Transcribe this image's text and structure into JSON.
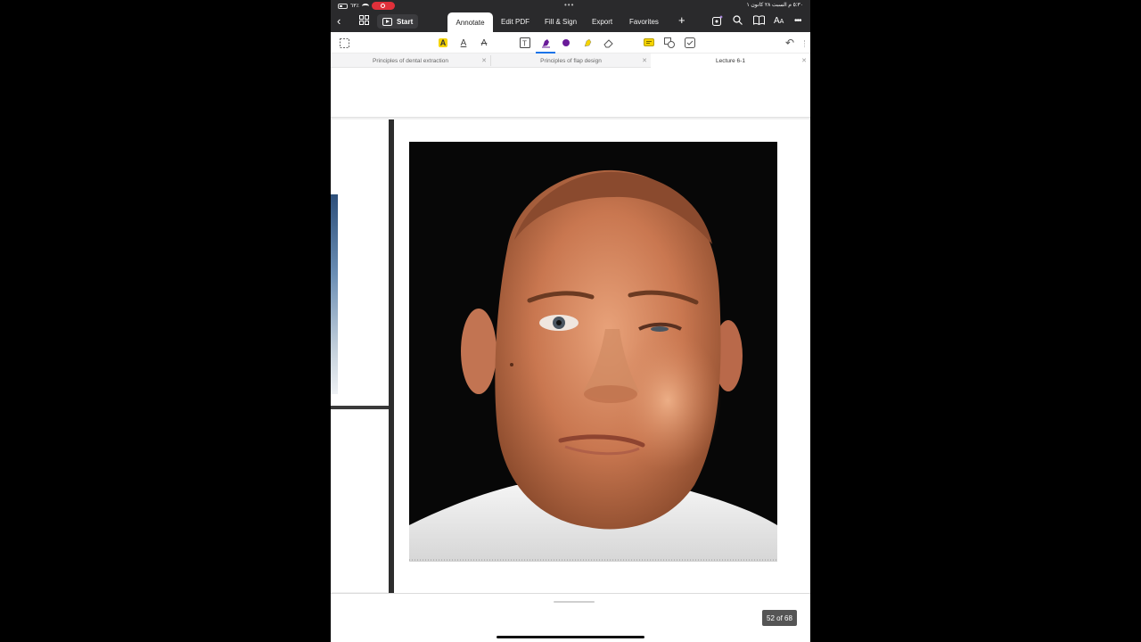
{
  "status_bar": {
    "battery": "٦٣٪",
    "datetime": "٥:٣٠ م   السبت ٢٨ كانون ١",
    "top_dots": "•••"
  },
  "top_toolbar": {
    "start_label": "Start",
    "tabs": [
      {
        "label": "Annotate",
        "active": true
      },
      {
        "label": "Edit PDF",
        "active": false
      },
      {
        "label": "Fill & Sign",
        "active": false
      },
      {
        "label": "Export",
        "active": false
      },
      {
        "label": "Favorites",
        "active": false
      }
    ],
    "icons": [
      "back-chevron",
      "grid",
      "plus",
      "ai-magic",
      "search",
      "book",
      "text-size",
      "more"
    ]
  },
  "annotation_tools": [
    "select",
    "highlight",
    "underline",
    "strikethrough",
    "text-box",
    "pen",
    "color-dot",
    "highlighter",
    "eraser",
    "comment",
    "shapes",
    "stamp",
    "undo"
  ],
  "colors": {
    "highlight": "#f5d400",
    "pen": "#6a1b9a",
    "comment": "#e3c800",
    "accent": "#1a73e8"
  },
  "document_tabs": [
    {
      "label": "Principles of dental extraction",
      "active": false
    },
    {
      "label": "Principles of flap design",
      "active": false
    },
    {
      "label": "Lecture 6-1",
      "active": true
    }
  ],
  "page_counter": "52 of 68"
}
